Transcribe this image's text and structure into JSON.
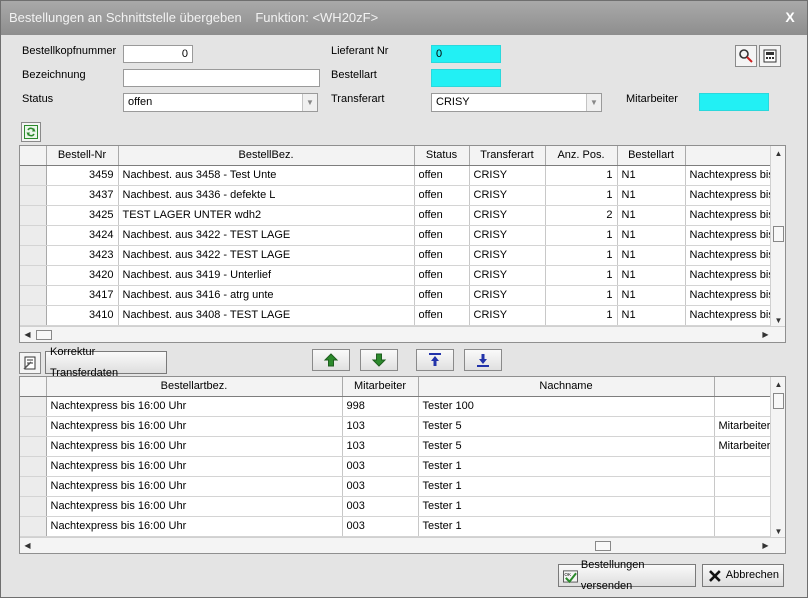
{
  "window": {
    "title": "Bestellungen an Schnittstelle übergeben",
    "function_label": "Funktion: <WH20zF>",
    "close_glyph": "X"
  },
  "form": {
    "bestellkopfnummer_label": "Bestellkopfnummer",
    "bestellkopfnummer_value": "0",
    "bezeichnung_label": "Bezeichnung",
    "bezeichnung_value": "",
    "status_label": "Status",
    "status_value": "offen",
    "lieferant_label": "Lieferant Nr",
    "lieferant_value": "0",
    "bestellart_label": "Bestellart",
    "bestellart_value": "",
    "transferart_label": "Transferart",
    "transferart_value": "CRISY",
    "mitarbeiter_label": "Mitarbeiter",
    "mitarbeiter_value": ""
  },
  "orders_table": {
    "columns": [
      "Bestell-Nr",
      "BestellBez.",
      "Status",
      "Transferart",
      "Anz. Pos.",
      "Bestellart",
      ""
    ],
    "rows": [
      [
        "3459",
        "Nachbest. aus 3458 - Test Unte",
        "offen",
        "CRISY",
        "1",
        "N1",
        "Nachtexpress bis"
      ],
      [
        "3437",
        "Nachbest. aus 3436 - defekte L",
        "offen",
        "CRISY",
        "1",
        "N1",
        "Nachtexpress bis"
      ],
      [
        "3425",
        "TEST LAGER UNTER wdh2",
        "offen",
        "CRISY",
        "2",
        "N1",
        "Nachtexpress bis"
      ],
      [
        "3424",
        "Nachbest. aus 3422 - TEST LAGE",
        "offen",
        "CRISY",
        "1",
        "N1",
        "Nachtexpress bis"
      ],
      [
        "3423",
        "Nachbest. aus 3422 - TEST LAGE",
        "offen",
        "CRISY",
        "1",
        "N1",
        "Nachtexpress bis"
      ],
      [
        "3420",
        "Nachbest. aus 3419 - Unterlief",
        "offen",
        "CRISY",
        "1",
        "N1",
        "Nachtexpress bis"
      ],
      [
        "3417",
        "Nachbest. aus 3416 - atrg unte",
        "offen",
        "CRISY",
        "1",
        "N1",
        "Nachtexpress bis"
      ],
      [
        "3410",
        "Nachbest. aus 3408 - TEST LAGE",
        "offen",
        "CRISY",
        "1",
        "N1",
        "Nachtexpress bis"
      ]
    ]
  },
  "korrektur_button": "Korrektur Transferdaten",
  "detail_table": {
    "columns": [
      "Bestellartbez.",
      "Mitarbeiter",
      "Nachname",
      ""
    ],
    "rows": [
      [
        "Nachtexpress bis 16:00 Uhr",
        "998",
        "Tester 100",
        ""
      ],
      [
        "Nachtexpress bis 16:00 Uhr",
        "103",
        "Tester 5",
        "Mitarbeiter"
      ],
      [
        "Nachtexpress bis 16:00 Uhr",
        "103",
        "Tester 5",
        "Mitarbeiter"
      ],
      [
        "Nachtexpress bis 16:00 Uhr",
        "003",
        "Tester 1",
        ""
      ],
      [
        "Nachtexpress bis 16:00 Uhr",
        "003",
        "Tester 1",
        ""
      ],
      [
        "Nachtexpress bis 16:00 Uhr",
        "003",
        "Tester 1",
        ""
      ],
      [
        "Nachtexpress bis 16:00 Uhr",
        "003",
        "Tester 1",
        ""
      ]
    ]
  },
  "footer": {
    "send_label": "Bestellungen versenden",
    "cancel_label": "Abbrechen"
  },
  "colors": {
    "cyan_field": "#22f0f4",
    "green_icon": "#2c8a2c",
    "blue_icon": "#2233aa"
  }
}
